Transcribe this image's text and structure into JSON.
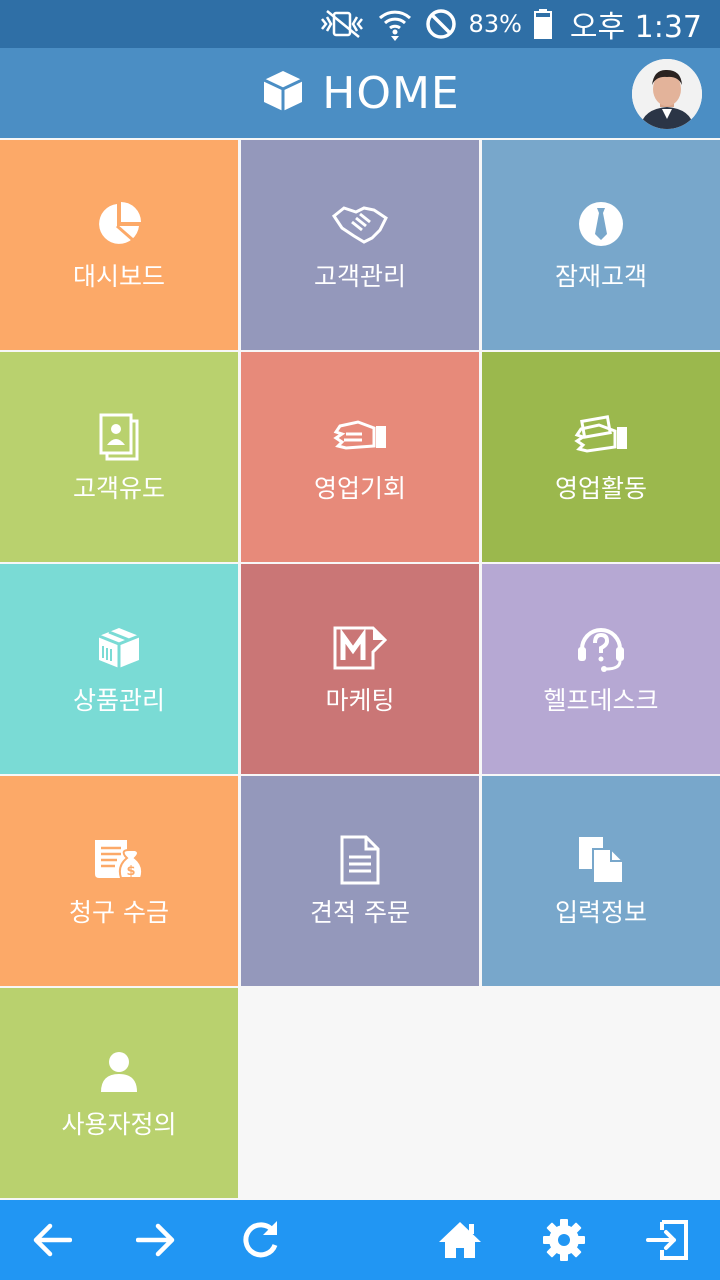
{
  "status_bar": {
    "battery_percent": "83%",
    "time": "오후 1:37",
    "icons": [
      "vibrate-mute-icon",
      "wifi-icon",
      "do-not-disturb-icon",
      "battery-icon"
    ]
  },
  "app_bar": {
    "title": "HOME",
    "title_icon": "cube-icon",
    "avatar": "profile-avatar"
  },
  "tiles": [
    {
      "label": "대시보드",
      "icon": "pie-chart-icon",
      "color": "#fca968"
    },
    {
      "label": "고객관리",
      "icon": "handshake-icon",
      "color": "#9498bb"
    },
    {
      "label": "잠재고객",
      "icon": "tie-icon",
      "color": "#78a7cb"
    },
    {
      "label": "고객유도",
      "icon": "contact-card-icon",
      "color": "#b9d16e"
    },
    {
      "label": "영업기회",
      "icon": "hand-card-icon",
      "color": "#e78a7a"
    },
    {
      "label": "영업활동",
      "icon": "hand-money-icon",
      "color": "#9bb84d"
    },
    {
      "label": "상품관리",
      "icon": "package-icon",
      "color": "#7adbd5"
    },
    {
      "label": "마케팅",
      "icon": "marketing-m-icon",
      "color": "#ca7676"
    },
    {
      "label": "헬프데스크",
      "icon": "headset-help-icon",
      "color": "#b6a8d3"
    },
    {
      "label": "청구 수금",
      "icon": "invoice-money-icon",
      "color": "#fca968"
    },
    {
      "label": "견적 주문",
      "icon": "document-icon",
      "color": "#9498bb"
    },
    {
      "label": "입력정보",
      "icon": "files-icon",
      "color": "#78a7cb"
    },
    {
      "label": "사용자정의",
      "icon": "user-icon",
      "color": "#b9d16e"
    }
  ],
  "nav_bar": {
    "buttons": [
      "back-arrow-icon",
      "forward-arrow-icon",
      "refresh-icon",
      "home-icon",
      "settings-gear-icon",
      "logout-icon"
    ]
  },
  "colors": {
    "status_bar": "#2f6fa6",
    "app_bar": "#4b8ec4",
    "nav_bar": "#2196f3"
  }
}
